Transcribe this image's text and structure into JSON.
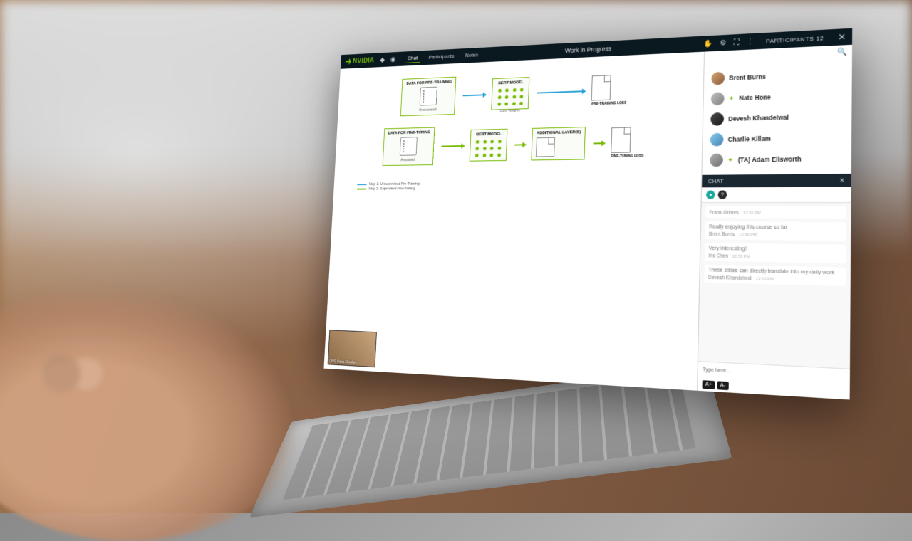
{
  "brand": "NVIDIA",
  "topbar": {
    "tabs": {
      "chat": "Chat",
      "participants": "Participants",
      "notes": "Notes"
    },
    "title": "Work in Progress",
    "participants_label": "PARTICIPANTS",
    "participants_count": "12"
  },
  "slide": {
    "row1": {
      "data_title": "DATA FOR PRE-TRAINING",
      "data_sub": "Unannotated",
      "model_title": "BERT MODEL",
      "loss_label": "PRE-TRAINING LOSS"
    },
    "copy_label": "Copy Weights",
    "row2": {
      "data_title": "DATA FOR FINE-TUNING",
      "data_sub": "Annotated",
      "model_title": "BERT MODEL",
      "additional_title": "ADDITIONAL LAYER(S)",
      "loss_label": "FINE-TUNING LOSS"
    },
    "legend": {
      "step1": "Step 1: Unsupervised Pre-Training",
      "step2": "Step 2: Supervised Fine-Tuning"
    }
  },
  "presenter_name": "(INS) Dana Sheahen",
  "participants": [
    {
      "name": "Brent Burns",
      "badge": false
    },
    {
      "name": "Nate Hone",
      "badge": true
    },
    {
      "name": "Devesh Khandelwal",
      "badge": false
    },
    {
      "name": "Charlie Killam",
      "badge": false
    },
    {
      "name": "(TA) Adam Ellsworth",
      "badge": true
    }
  ],
  "chat": {
    "header": "CHAT",
    "messages": [
      {
        "author": "Frank Grimes",
        "time": "12:56 PM",
        "text": ""
      },
      {
        "author": "Brent Burns",
        "time": "12:56 PM",
        "text": "Really enjoying this course so far"
      },
      {
        "author": "Iris Chen",
        "time": "12:59 PM",
        "text": "Very interesting!"
      },
      {
        "author": "Devesh Khandelwal",
        "time": "12:59 PM",
        "text": "These slides can directly translate into my daily work"
      }
    ],
    "placeholder": "Type here...",
    "font_inc": "A+",
    "font_dec": "A-"
  }
}
